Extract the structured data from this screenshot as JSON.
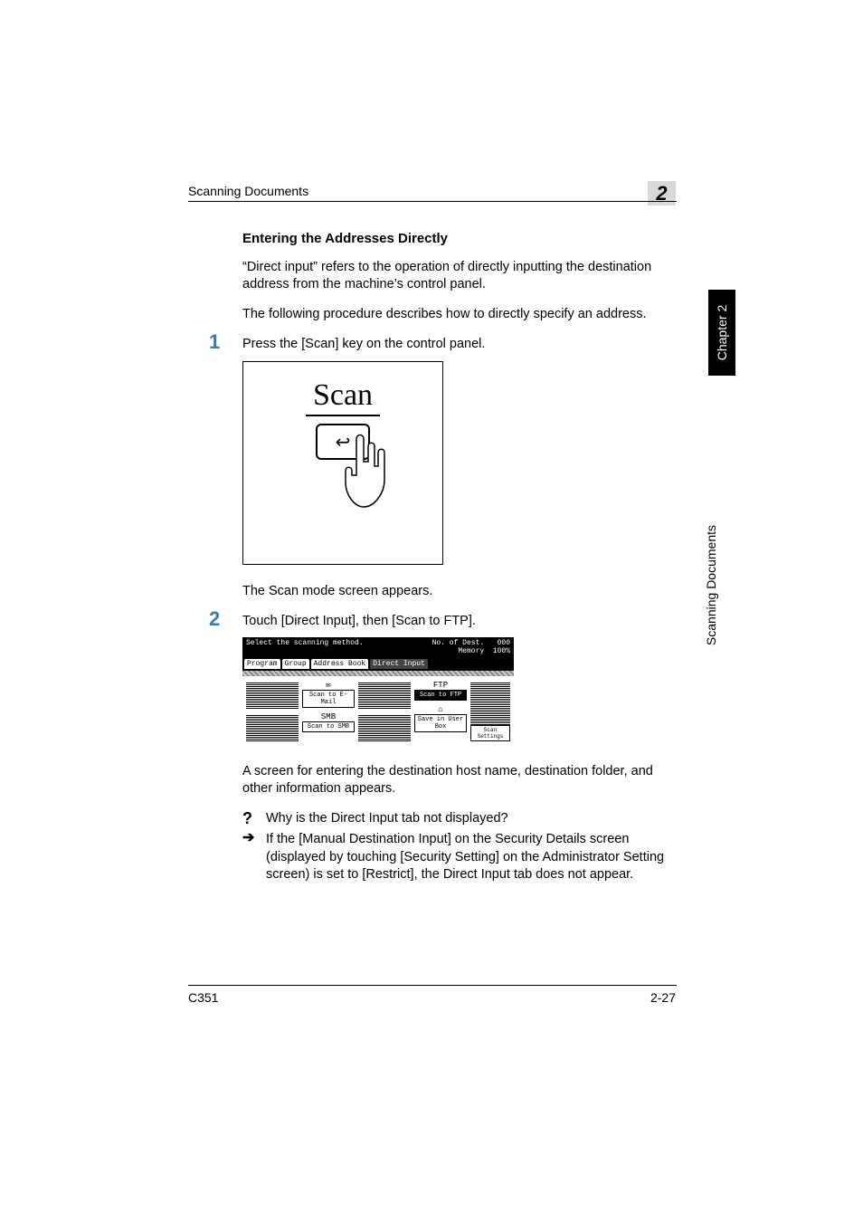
{
  "header": {
    "section": "Scanning Documents",
    "chapter_badge": "2"
  },
  "sidebar": {
    "chapter_tab": "Chapter 2",
    "section_label": "Scanning Documents"
  },
  "section": {
    "heading": "Entering the Addresses Directly"
  },
  "paras": {
    "intro1": "“Direct input” refers to the operation of directly inputting the destination address from the machine’s control panel.",
    "intro2": "The following procedure describes how to directly specify an address."
  },
  "steps": {
    "s1": {
      "num": "1",
      "text": "Press the [Scan] key on the control panel.",
      "after": "The Scan mode screen appears."
    },
    "s2": {
      "num": "2",
      "text": "Touch [Direct Input], then [Scan to FTP].",
      "after": "A screen for entering the destination host name, destination folder, and other information appears.",
      "q": "Why is the Direct Input tab not displayed?",
      "a": "If the [Manual Destination Input] on the Security Details screen (displayed by touching [Security Setting] on the Administrator Setting screen) is set to [Restrict], the Direct Input tab does not appear."
    }
  },
  "scan_button": {
    "label": "Scan"
  },
  "lcd": {
    "title": "Select the scanning method.",
    "status_dest_label": "No. of Dest.",
    "status_dest_value": "000",
    "memory_label": "Memory",
    "memory_value": "100%",
    "tabs": {
      "program": "Program",
      "group": "Group",
      "address_book": "Address Book",
      "direct_input": "Direct Input"
    },
    "buttons": {
      "scan_to_email": "Scan to E-Mail",
      "scan_to_ftp": "Scan to FTP",
      "scan_to_smb": "Scan to SMB",
      "save_in_user_box": "Save in User Box",
      "scan_settings": "Scan Settings"
    },
    "icons": {
      "ftp": "FTP",
      "smb": "SMB"
    }
  },
  "footer": {
    "model": "C351",
    "page": "2-27"
  }
}
